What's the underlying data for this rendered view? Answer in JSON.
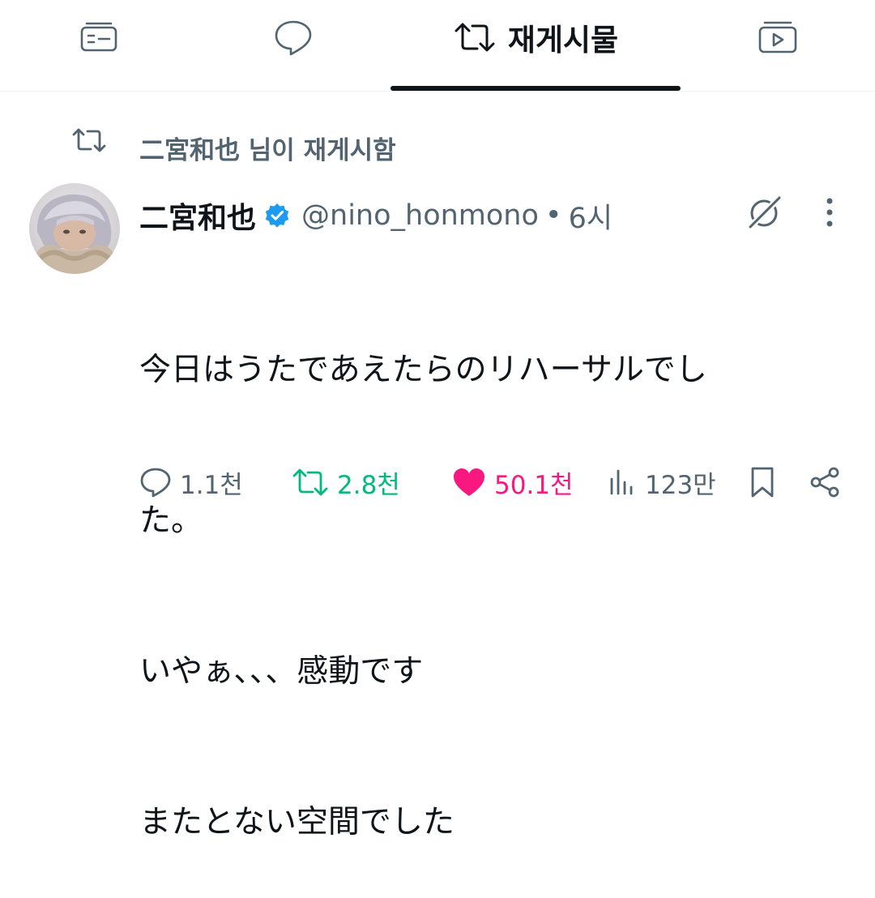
{
  "tabs": [
    {
      "icon": "posts-card-icon",
      "active": false
    },
    {
      "icon": "reply-bubble-icon",
      "active": false
    },
    {
      "icon": "repost-icon",
      "label": "재게시물",
      "active": true
    },
    {
      "icon": "media-play-icon",
      "active": false
    }
  ],
  "repost_notice": "二宮和也 님이 재게시함",
  "post": {
    "author_name": "二宮和也",
    "handle": "@nino_honmono",
    "separator": "•",
    "time": "6시",
    "text": "今日はうたであえたらのリハーサルでした。\nいやぁ、、、感動です\nまたとない空間でした",
    "text_lines": [
      "今日はうたであえたらのリハーサルでし",
      "た。",
      "いやぁ、、、感動です",
      "またとない空間でした"
    ]
  },
  "actions": {
    "replies": "1.1천",
    "reposts": "2.8천",
    "likes": "50.1천",
    "views": "123만"
  },
  "colors": {
    "text_primary": "#0f1419",
    "text_secondary": "#536471",
    "repost_green": "#00ba7c",
    "like_pink": "#f91880",
    "verified_blue": "#1d9bf0"
  }
}
